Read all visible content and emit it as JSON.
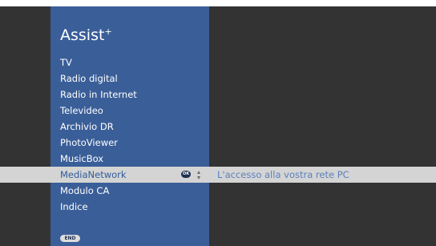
{
  "menu": {
    "title": "Assist",
    "title_superscript": "+",
    "items": [
      {
        "label": "TV"
      },
      {
        "label": "Radio digital"
      },
      {
        "label": "Radio in Internet"
      },
      {
        "label": "Televideo"
      },
      {
        "label": "Archivio DR"
      },
      {
        "label": "PhotoViewer"
      },
      {
        "label": "MusicBox"
      },
      {
        "label": "MediaNetwork"
      },
      {
        "label": "Modulo CA"
      },
      {
        "label": "Indice"
      }
    ],
    "selected_index": 7,
    "selected_hint": "L'accesso alla vostra rete PC",
    "ok_label": "OK",
    "end_label": "END"
  },
  "colors": {
    "panel": "#3a5e98",
    "background": "#333333",
    "selection_bar": "#d4d4d4",
    "hint_text": "#5b80bd"
  },
  "icons": [
    "ok-button-icon",
    "up-down-arrows-icon",
    "end-button-icon"
  ]
}
